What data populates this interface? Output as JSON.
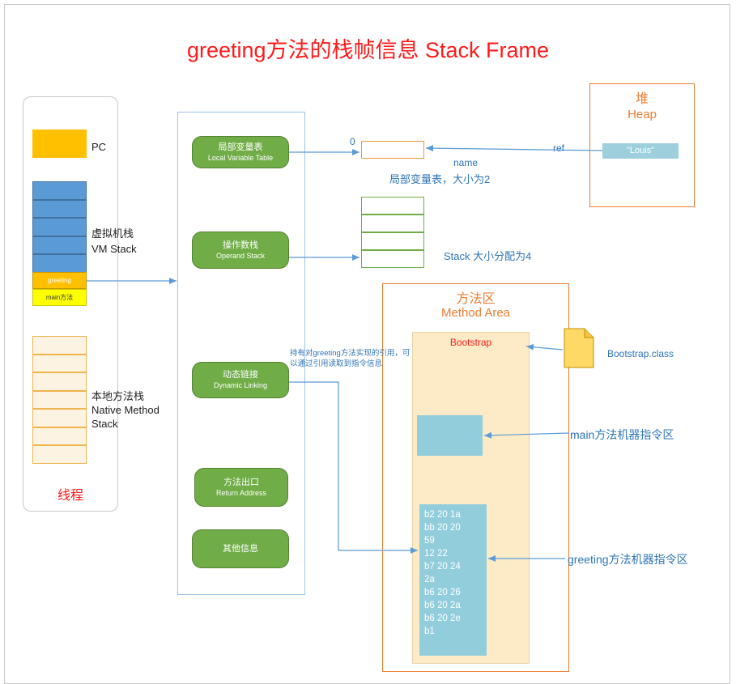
{
  "title": "greeting方法的栈帧信息  Stack Frame",
  "thread": {
    "pc_label": "PC",
    "vm_stack_zh": "虚拟机栈",
    "vm_stack_en": "VM Stack",
    "greeting_cell": "greeting",
    "main_cell": "main方法",
    "native_zh": "本地方法栈",
    "native_en1": "Native Method",
    "native_en2": "Stack",
    "label": "线程"
  },
  "frame": {
    "lvt_zh": "局部变量表",
    "lvt_en": "Local Variable Table",
    "op_zh": "操作数栈",
    "op_en": "Operand Stack",
    "dl_zh": "动态链接",
    "dl_en": "Dynamic Linking",
    "ra_zh": "方法出口",
    "ra_en": "Return Address",
    "other_zh": "其他信息"
  },
  "lvt": {
    "index": "0",
    "var_name": "name",
    "size_note": "局部变量表，大小为2",
    "ref_label": "ref"
  },
  "opstack": {
    "size_note": "Stack 大小分配为4"
  },
  "heap": {
    "title_zh": "堆",
    "title_en": "Heap",
    "value": "\"Louis\""
  },
  "method_area": {
    "title_zh": "方法区",
    "title_en": "Method Area",
    "bootstrap": "Bootstrap",
    "class_file": "Bootstrap.class",
    "main_instr": "main方法机器指令区",
    "greeting_instr": "greeting方法机器指令区",
    "dl_note": "持有对greeting方法实现的引用，可以通过引用读取到指令信息",
    "bytecode": [
      "b2 20 1a",
      "bb 20 20",
      "59",
      "12 22",
      "b7 20 24",
      "2a",
      "b6 20 26",
      "b6 20 2a",
      "b6 20 2e",
      "b1"
    ]
  },
  "colors": {
    "title_red": "#ff1a1a",
    "pc_orange": "#ffc000",
    "vm_blue": "#5b9bd5",
    "pill_green": "#70ad47",
    "heap_orange": "#ed7d31",
    "code_cyan": "#92cddc",
    "arrow_blue": "#5b9bd5"
  }
}
